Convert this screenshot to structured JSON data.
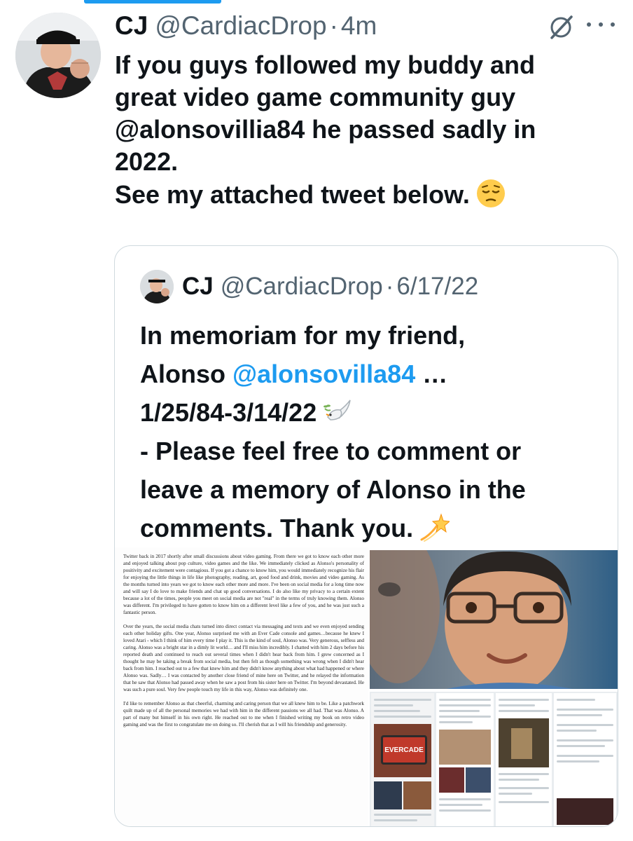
{
  "tweet": {
    "author_name": "CJ",
    "author_handle": "@CardiacDrop",
    "separator": "·",
    "time": "4m",
    "text_lines": [
      "If you guys followed my buddy and",
      "great video game community guy",
      "@alonsovillia84 he passed sadly in",
      "2022.",
      "See my attached tweet below."
    ],
    "emoji": "pensive-face"
  },
  "quote": {
    "author_name": "CJ",
    "author_handle": "@CardiacDrop",
    "separator": "·",
    "date": "6/17/22",
    "text_lines": [
      {
        "pre": "In memoriam for my friend,",
        "mention": "",
        "post": ""
      },
      {
        "pre": "Alonso ",
        "mention": "@alonsovilla84",
        "post": " …"
      },
      {
        "pre": "1/25/84-3/14/22",
        "mention": "",
        "post": ""
      },
      {
        "pre": "- Please feel free to comment or",
        "mention": "",
        "post": ""
      },
      {
        "pre": "leave a memory of Alonso in the",
        "mention": "",
        "post": ""
      },
      {
        "pre": "comments. Thank you.",
        "mention": "",
        "post": ""
      }
    ],
    "emojis": [
      "dove-icon",
      "dizzy-icon"
    ]
  },
  "media": {
    "document_paragraphs": [
      "Twitter back in 2017 shortly after small discussions about video gaming. From there we got to know each other more and enjoyed talking about pop culture, video games and the like. We immediately clicked as Alonso's personality of positivity and excitement were contagious. If you got a chance to know him, you would immediately recognize his flair for enjoying the little things in life like photography, reading, art, good food and drink, movies and video gaming. As the months turned into years we got to know each other more and more. I've been on social media for a long time now and will say I do love to make friends and chat up good conversations. I do also like my privacy to a certain extent because a lot of the times, people you meet on social media are not \"real\" in the terms of truly knowing them. Alonso was different. I'm privileged to have gotten to know him on a different level like a few of you, and he was just such a fantastic person.",
      "Over the years, the social media chats turned into direct contact via messaging and texts and we even enjoyed sending each other holiday gifts. One year, Alonso surprised me with an Ever Cade console and games…because he knew I loved Atari - which I think of him every time I play it. This is the kind of soul, Alonso was. Very generous, selfless and caring. Alonso was a bright star in a dimly lit world… and I'll miss him incredibly. I chatted with him 2 days before his reported death and continued to reach out several times when I didn't hear back from him. I grew concerned as I thought he may be taking a break from social media, but then felt as though something was wrong when I didn't hear back from him. I reached out to a few that knew him and they didn't know anything about what had happened or where Alonso was. Sadly… I was contacted by another close friend of mine here on Twitter, and he relayed the information that he saw that Alonso had passed away when he saw a post from his sister here on Twitter. I'm beyond devastated.\nHe was such a pure soul. Very few people touch my life in this way, Alonso was definitely one.",
      "I'd like to remember Alonso as that cheerful, charming and caring person that we all knew him to be. Like a patchwork quilt made up of all the personal memories we had with him in the different passions we all had. That was Alonso. A part of many but himself in his own right. He reached out to me when I finished writing my book on retro video gaming and was the first to congratulate me on doing so. I'll cherish that as I will his friendship and generosity."
    ],
    "collage_label": "EVERCADE"
  },
  "colors": {
    "link": "#1d9bf0",
    "muted": "#536471",
    "border": "#cfd9de",
    "text": "#0f1419"
  }
}
